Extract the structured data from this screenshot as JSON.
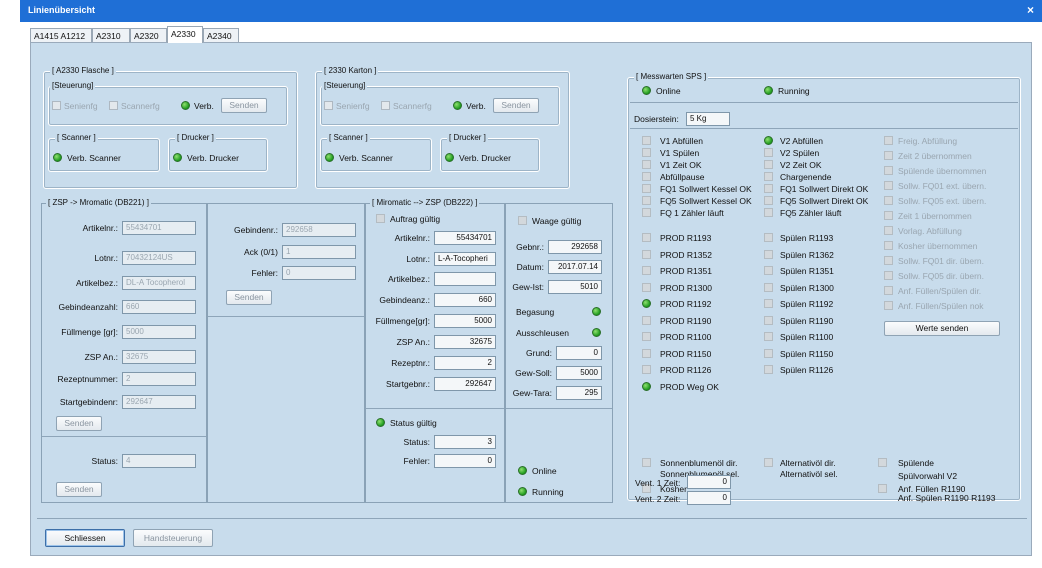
{
  "window": {
    "title": "Linienübersicht",
    "close": "×"
  },
  "tabs": [
    "A1415 A1212",
    "A2310",
    "A2320",
    "A2330",
    "A2340"
  ],
  "flasche": {
    "title": "[ A2330 Flasche ]",
    "steuerung": "[Steuerung]",
    "senienfg": "Senienfg",
    "scannerfg": "Scannerfg",
    "verb": "Verb.",
    "senden": "Senden",
    "scanner": "[ Scanner ]",
    "drucker": "[ Drucker ]",
    "verb_scanner": "Verb. Scanner",
    "verb_drucker": "Verb. Drucker"
  },
  "karton": {
    "title": "[ 2330 Karton ]",
    "steuerung": "[Steuerung]",
    "senienfg": "Senienfg",
    "scannerfg": "Scannerfg",
    "verb": "Verb.",
    "senden": "Senden",
    "scanner": "[ Scanner ]",
    "drucker": "[ Drucker ]",
    "verb_scanner": "Verb. Scanner",
    "verb_drucker": "Verb. Drucker"
  },
  "zsp": {
    "title": "[ ZSP -> Mromatic (DB221) ]",
    "artikelnr_l": "Artikelnr.:",
    "artikelnr": "55434701",
    "lotnr_l": "Lotnr.:",
    "lotnr": "70432124US",
    "artikelbez_l": "Artikelbez.:",
    "artikelbez": "DL-A Tocopherol",
    "gebindeanzahl_l": "Gebindeanzahl:",
    "gebindeanzahl": "660",
    "fuellmenge_l": "Füllmenge [gr]:",
    "fuellmenge": "5000",
    "zsp_an_l": "ZSP An.:",
    "zsp_an": "32675",
    "rezeptnummer_l": "Rezeptnummer:",
    "rezeptnummer": "2",
    "startgebinde_l": "Startgebindenr:",
    "startgebinde": "292647",
    "senden": "Senden",
    "status_l": "Status:",
    "status": "4",
    "senden2": "Senden"
  },
  "mid": {
    "gebindenr_l": "Gebindenr.:",
    "gebindenr": "292658",
    "ack_l": "Ack (0/1)",
    "ack": "1",
    "fehler_l": "Fehler:",
    "fehler": "0",
    "senden": "Senden"
  },
  "miromatic": {
    "title": "[ Miromatic --> ZSP (DB222) ]",
    "auftrag": "Auftrag gültig",
    "artikelnr_l": "Artikelnr.:",
    "artikelnr": "55434701",
    "lotnr_l": "Lotnr.:",
    "lotnr": "L-A-Tocopheri",
    "artikelbez_l": "Artikelbez.:",
    "artikelbez": "",
    "gebindeanz_l": "Gebindeanz.:",
    "gebindeanz": "660",
    "fuellmenge_l": "Füllmenge[gr]:",
    "fuellmenge": "5000",
    "zsp_an_l": "ZSP An.:",
    "zsp_an": "32675",
    "rezeptnr_l": "Rezeptnr.:",
    "rezeptnr": "2",
    "startgebnr_l": "Startgebnr.:",
    "startgebnr": "292647",
    "status_gueltig": "Status gültig",
    "status_l": "Status:",
    "status": "3",
    "fehler_l": "Fehler:",
    "fehler": "0"
  },
  "waage": {
    "title": "Waage gültig",
    "gebnr_l": "Gebnr.:",
    "gebnr": "292658",
    "datum_l": "Datum:",
    "datum": "2017.07.14",
    "gew_ist_l": "Gew-Ist:",
    "gew_ist": "5010",
    "begasung": "Begasung",
    "ausschleusen": "Ausschleusen",
    "grund_l": "Grund:",
    "grund": "0",
    "gew_soll_l": "Gew-Soll:",
    "gew_soll": "5000",
    "gew_tara_l": "Gew-Tara:",
    "gew_tara": "295",
    "online": "Online",
    "running": "Running"
  },
  "sps": {
    "title": "[ Messwarten SPS ]",
    "online": "Online",
    "running": "Running",
    "dosierstein_l": "Dosierstein:",
    "dosierstein": "5 Kg",
    "col1": [
      "V1 Abfüllen",
      "V1 Spülen",
      "V1 Zeit OK",
      "Abfüllpause",
      "FQ1 Sollwert Kessel OK",
      "FQ5 Sollwert Kessel OK",
      "FQ 1 Zähler läuft"
    ],
    "col2": [
      "V2 Abfüllen",
      "V2 Spülen",
      "V2 Zeit OK",
      "Chargenende",
      "FQ1 Sollwert Direkt OK",
      "FQ5 Sollwert Direkt OK",
      "FQ5 Zähler läuft"
    ],
    "col3": [
      "Freig. Abfüllung",
      "Zeit 2 übernommen",
      "Spülende übernommen",
      "Sollw. FQ01 ext. übern.",
      "Sollw. FQ05 ext. übern.",
      "Zeit 1 übernommen",
      "Vorlag. Abfüllung",
      "Kosher übernommen",
      "Sollw. FQ01 dir. übern.",
      "Sollw. FQ05 dir. übern.",
      "Anf. Füllen/Spülen dir.",
      "Anf. Füllen/Spülen nok"
    ],
    "prod": [
      "PROD R1193",
      "PROD R1352",
      "PROD R1351",
      "PROD R1300",
      "PROD R1192",
      "PROD R1190",
      "PROD R1100",
      "PROD R1150",
      "PROD R1126",
      "PROD Weg OK"
    ],
    "spuelen": [
      "Spülen R1193",
      "Spülen R1362",
      "Spülen R1351",
      "Spülen R1300",
      "Spülen R1192",
      "Spülen R1190",
      "Spülen R1100",
      "Spülen R1150",
      "Spülen R1126"
    ],
    "werte_senden": "Werte senden",
    "sonnen_dir": "Sonnenblumenöl dir.",
    "sonnen_sel": "Sonnenblumenöl sel.",
    "kosher": "Kosher",
    "alt_dir": "Alternativöl dir.",
    "alt_sel": "Alternativöl sel.",
    "spuelende": "Spülende",
    "spuelvorwahl": "Spülvorwahl V2",
    "anf_fuellen": "Anf. Füllen R1190",
    "anf_spuelen": "Anf. Spülen R1190 R1193",
    "vent1_l": "Vent. 1 Zeit:",
    "vent1": "0",
    "vent2_l": "Vent. 2 Zeit:",
    "vent2": "0"
  },
  "footer": {
    "schliessen": "Schliessen",
    "handsteuerung": "Handsteuerung"
  }
}
